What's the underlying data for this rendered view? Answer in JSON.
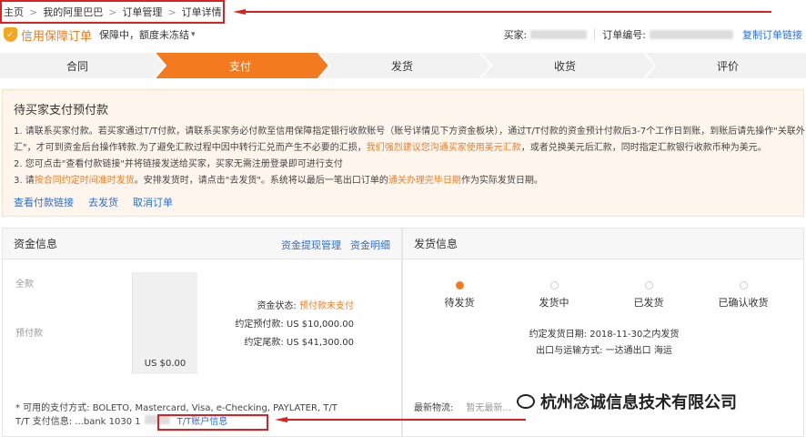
{
  "breadcrumb": [
    "主页",
    "我的阿里巴巴",
    "订单管理",
    "订单详情"
  ],
  "header": {
    "title": "信用保障订单",
    "status": "保障中，额度未冻结",
    "buyer_label": "买家:",
    "order_no_label": "订单编号:",
    "copy_link": "复制订单链接"
  },
  "steps": [
    "合同",
    "支付",
    "发货",
    "收货",
    "评价"
  ],
  "active_step": 1,
  "notice": {
    "title": "待买家支付预付款",
    "line1": "1. 请联系买家付款。若买家通过T/T付款，请联系买家务必付款至信用保障指定银行收款账号（账号详情见下方资金板块），通过T/T付款的资金预计付款后3-7个工作日到账，到账后请先操作\"关联外",
    "line2a": "汇\"，才可到资金后台操作转款.为了避免汇款过程中因中转行汇兑而产生不必要的汇损，",
    "line2b": "我们强烈建议您沟通买家使用美元汇款",
    "line2c": "，或者兑换美元后汇款，同时指定汇款银行收款币种为美元。",
    "line3": "2. 您可点击\"查看付款链接\"并将链接发送给买家，买家无需注册登录即可进行支付",
    "line4a": "3. 请",
    "line4b": "按合同约定时间准时发货",
    "line4c": "。安排发货时，请点击\"去发货\"。系统将以最后一笔出口订单的",
    "line4d": "通关办理完毕日期",
    "line4e": "作为实际发货日期。",
    "actions": [
      "查看付款链接",
      "去发货",
      "取消订单"
    ]
  },
  "fund": {
    "title": "资金信息",
    "links": [
      "资金提现管理",
      "资金明细"
    ],
    "label_total": "全款",
    "label_prepay": "预付款",
    "column_value": "US $0.00",
    "status_label": "资金状态:",
    "status_value": "预付款未支付",
    "prepay_label": "约定预付款:",
    "prepay_value": "US $10,000.00",
    "balance_label": "约定尾款:",
    "balance_value": "US $41,300.00",
    "payment_methods": "* 可用的支付方式: BOLETO, Mastercard, Visa, e-Checking, PAYLATER, T/T",
    "tt_line_prefix": "T/T 支付信息: ...bank 1030 1",
    "tt_link": "T/T账户信息"
  },
  "shipping": {
    "title": "发货信息",
    "steps": [
      "待发货",
      "发货中",
      "已发货",
      "已确认收货"
    ],
    "active_step": 0,
    "date_line": "约定发货日期: 2018-11-30之内发货",
    "mode_line": "出口与运输方式: 一达通出口 海运",
    "logistics_label": "最新物流:",
    "logistics_value": "暂无最新..."
  },
  "watermark": "杭州念诚信息技术有限公司",
  "colors": {
    "accent": "#f47a20",
    "link": "#2a6ed6",
    "highlight": "#e02020"
  }
}
